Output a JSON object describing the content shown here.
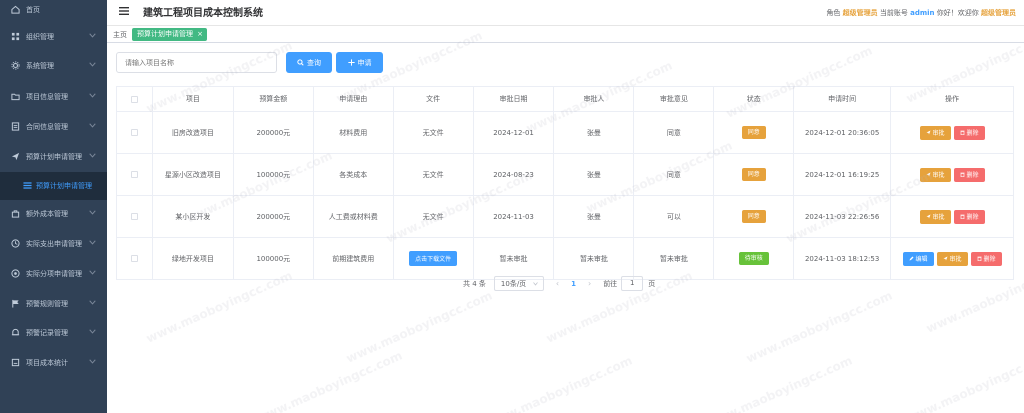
{
  "sidebar": {
    "items": [
      {
        "label": "首页",
        "icon": "home-icon",
        "chevron": false
      },
      {
        "label": "组织管理",
        "icon": "grid-icon",
        "chevron": true
      },
      {
        "label": "系统管理",
        "icon": "gear-icon",
        "chevron": true
      },
      {
        "label": "项目信息管理",
        "icon": "folder-icon",
        "chevron": true
      },
      {
        "label": "合同信息管理",
        "icon": "document-icon",
        "chevron": true
      },
      {
        "label": "预算计划申请管理",
        "icon": "send-icon",
        "chevron": true
      },
      {
        "label": "预算计划申请管理",
        "icon": "list-icon",
        "chevron": false,
        "active": true
      },
      {
        "label": "额外成本管理",
        "icon": "bag-icon",
        "chevron": true
      },
      {
        "label": "实际支出申请管理",
        "icon": "clock-icon",
        "chevron": true
      },
      {
        "label": "实际分项申请管理",
        "icon": "settings-circle-icon",
        "chevron": true
      },
      {
        "label": "预警规则管理",
        "icon": "flag-icon",
        "chevron": true
      },
      {
        "label": "预警记录管理",
        "icon": "bell-icon",
        "chevron": true
      },
      {
        "label": "项目成本统计",
        "icon": "chart-icon",
        "chevron": true
      }
    ]
  },
  "header": {
    "title": "建筑工程项目成本控制系统",
    "role_prefix": "角色",
    "role": "超级管理员",
    "account_prefix": "当前账号",
    "account": "admin",
    "greeting": "你好！欢迎你",
    "username": "超级管理员"
  },
  "tags": {
    "breadcrumb": "主页",
    "active_tag": "预算计划申请管理",
    "close": "×"
  },
  "toolbar": {
    "search_placeholder": "请输入项目名称",
    "query_label": "查询",
    "apply_label": "申请"
  },
  "table": {
    "columns": [
      "项目",
      "预算金额",
      "申请理由",
      "文件",
      "审批日期",
      "审批人",
      "审批意见",
      "状态",
      "申请时间",
      "操作"
    ],
    "rows": [
      {
        "project": "旧房改造项目",
        "amount": "200000元",
        "reason": "材料费用",
        "file": "无文件",
        "file_is_button": false,
        "date": "2024-12-01",
        "approver": "张曼",
        "opinion": "同意",
        "status": "同意",
        "status_color": "#e6a23c",
        "time": "2024-12-01 20:36:05",
        "edit": false
      },
      {
        "project": "星源小区改造项目",
        "amount": "100000元",
        "reason": "各类成本",
        "file": "无文件",
        "file_is_button": false,
        "date": "2024-08-23",
        "approver": "张曼",
        "opinion": "同意",
        "status": "同意",
        "status_color": "#e6a23c",
        "time": "2024-12-01 16:19:25",
        "edit": false
      },
      {
        "project": "某小区开发",
        "amount": "200000元",
        "reason": "人工费或材料费",
        "file": "无文件",
        "file_is_button": false,
        "date": "2024-11-03",
        "approver": "张曼",
        "opinion": "可以",
        "status": "同意",
        "status_color": "#e6a23c",
        "time": "2024-11-03 22:26:56",
        "edit": false
      },
      {
        "project": "绿地开发项目",
        "amount": "100000元",
        "reason": "前期建筑费用",
        "file": "点击下载文件",
        "file_is_button": true,
        "date": "暂未审批",
        "approver": "暂未审批",
        "opinion": "暂未审批",
        "status": "待审核",
        "status_color": "#67c23a",
        "time": "2024-11-03 18:12:53",
        "edit": true
      }
    ],
    "op_edit": "编辑",
    "op_approve": "审批",
    "op_delete": "删除"
  },
  "pagination": {
    "total": "共 4 条",
    "page_size": "10条/页",
    "current_page": "1",
    "goto_label": "前往",
    "goto_value": "1",
    "unit": "页"
  },
  "watermark": "www.maoboyingcc.com"
}
